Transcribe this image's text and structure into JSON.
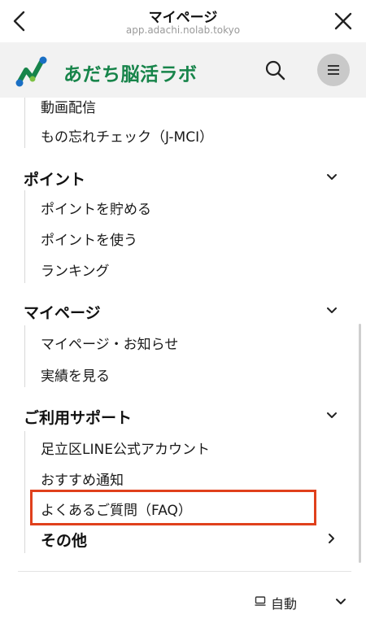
{
  "browser": {
    "title": "マイページ",
    "url": "app.adachi.nolab.tokyo"
  },
  "site": {
    "name": "あだち脳活ラボ",
    "brand_color": "#17844a"
  },
  "menu": {
    "items_top": [
      "動画配信",
      "もの忘れチェック（J-MCI）"
    ],
    "sections": [
      {
        "heading": "ポイント",
        "items": [
          "ポイントを貯める",
          "ポイントを使う",
          "ランキング"
        ],
        "expanded": true
      },
      {
        "heading": "マイページ",
        "items": [
          "マイページ・お知らせ",
          "実績を見る"
        ],
        "expanded": true
      },
      {
        "heading": "ご利用サポート",
        "items": [
          "足立区LINE公式アカウント",
          "おすすめ通知",
          "よくあるご質問（FAQ）"
        ],
        "expanded": true
      },
      {
        "heading": "その他",
        "items": [],
        "expanded": false
      }
    ]
  },
  "footer": {
    "theme_label": "自動"
  },
  "highlight_color": "#e0401c"
}
